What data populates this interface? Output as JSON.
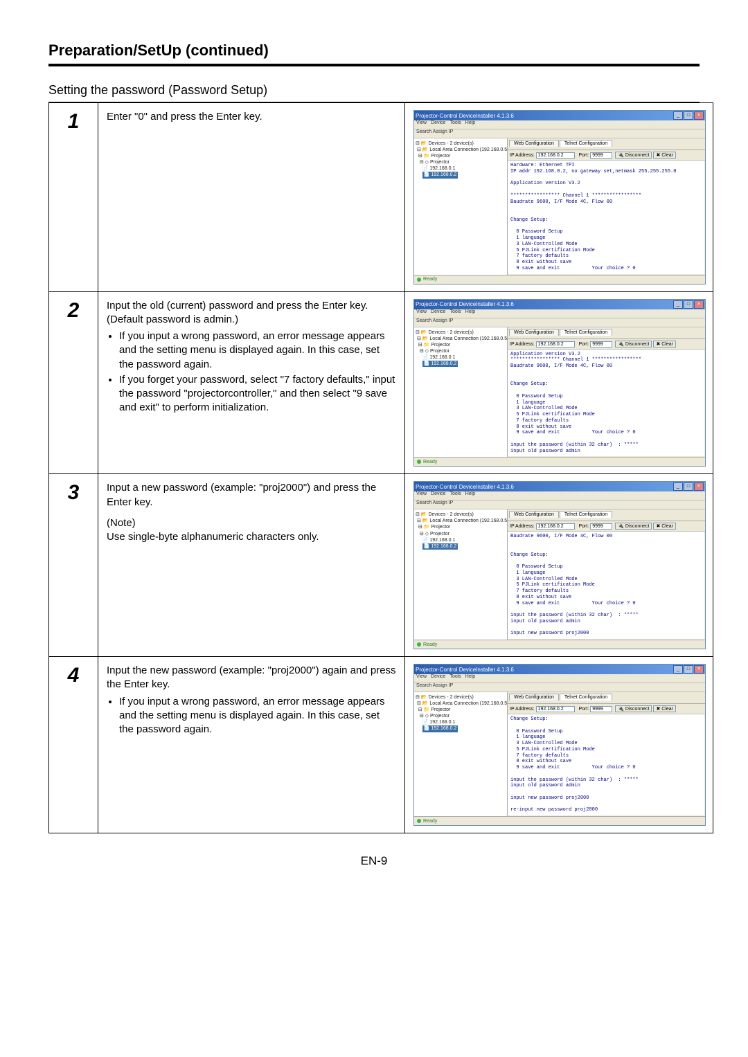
{
  "page": {
    "header": "Preparation/SetUp (continued)",
    "subtitle": "Setting the password (Password Setup)",
    "footer": "EN-9"
  },
  "window_common": {
    "title": "Projector-Control DeviceInstaller 4.1.3.6",
    "menu": [
      "View",
      "Device",
      "Tools",
      "Help"
    ],
    "toolbar": "Search    Assign IP",
    "tree": {
      "root": "Devices - 2 device(s)",
      "lan": "Local Area Connection (192.168.0.5 )",
      "proj_group": "Projector",
      "proj_sub": "Projector",
      "ip1": "192.168.0.1",
      "ip2": "192.168.0.2"
    },
    "tabs": {
      "web": "Web Configuration",
      "telnet": "Telnet Configuration"
    },
    "conn": {
      "ip_label": "IP Address:",
      "ip": "192.168.0.2",
      "port_label": "Port:",
      "port": "9999",
      "disconnect": "Disconnect",
      "clear": "Clear"
    },
    "status": "Ready",
    "winctrls": {
      "min": "_",
      "max": "□",
      "close": "×"
    }
  },
  "steps": [
    {
      "num": "1",
      "text": "Enter \"0\" and press the Enter key.",
      "bullets": [],
      "note": null,
      "note_text": null,
      "terminal": "Hardware: Ethernet TPI\nIP addr 192.168.0.2, no gateway set,netmask 255.255.255.0\n\nApplication version V3.2\n\n***************** Channel 1 *****************\nBaudrate 9600, I/F Mode 4C, Flow 00\n\n\nChange Setup:\n\n  0 Password Setup\n  1 language\n  3 LAN-Controlled Mode\n  5 PJLink certification Mode\n  7 factory defaults\n  8 exit without save\n  9 save and exit           Your choice ? 0"
    },
    {
      "num": "2",
      "text": "Input the old (current) password and press the Enter key. (Default password is admin.)",
      "bullets": [
        "If you input a wrong password, an error message appears and the setting menu is displayed again. In this case, set the password again.",
        "If you forget your password, select \"7 factory defaults,\" input the password \"projectorcontroller,\" and then select \"9 save and exit\" to perform initialization."
      ],
      "note": null,
      "note_text": null,
      "terminal": "Application version V3.2\n***************** Channel 1 *****************\nBaudrate 9600, I/F Mode 4C, Flow 00\n\n\nChange Setup:\n\n  0 Password Setup\n  1 language\n  3 LAN-Controlled Mode\n  5 PJLink certification Mode\n  7 factory defaults\n  8 exit without save\n  9 save and exit           Your choice ? 0\n\ninput the password (within 32 char)  : *****\ninput old password admin"
    },
    {
      "num": "3",
      "text": "Input a new password (example: \"proj2000\") and press the Enter key.",
      "bullets": [],
      "note": "(Note)",
      "note_text": "Use single-byte alphanumeric characters only.",
      "terminal": "Baudrate 9600, I/F Mode 4C, Flow 00\n\n\nChange Setup:\n\n  0 Password Setup\n  1 language\n  3 LAN-Controlled Mode\n  5 PJLink certification Mode\n  7 factory defaults\n  8 exit without save\n  9 save and exit           Your choice ? 0\n\ninput the password (within 32 char)  : *****\ninput old password admin\n\ninput new password proj2000"
    },
    {
      "num": "4",
      "text": "Input the new password (example: \"proj2000\") again and press the Enter key.",
      "bullets": [
        "If you input a wrong password, an error message appears and the setting menu is displayed again. In this case, set the password again."
      ],
      "note": null,
      "note_text": null,
      "terminal": "Change Setup:\n\n  0 Password Setup\n  1 language\n  3 LAN-Controlled Mode\n  5 PJLink certification Mode\n  7 factory defaults\n  8 exit without save\n  9 save and exit           Your choice ? 0\n\ninput the password (within 32 char)  : *****\ninput old password admin\n\ninput new password proj2000\n\nre-input new password proj2000"
    }
  ]
}
